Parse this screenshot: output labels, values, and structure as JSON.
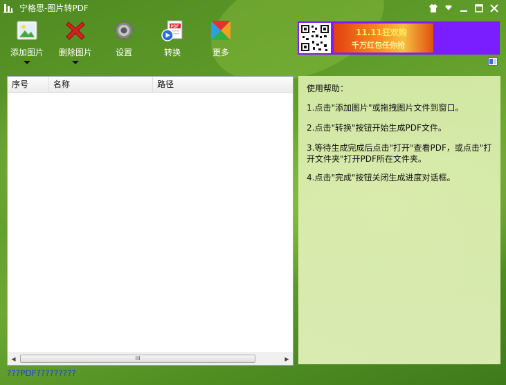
{
  "window": {
    "title": "宁格思-图片转PDF"
  },
  "toolbar": {
    "add_label": "添加图片",
    "delete_label": "删除图片",
    "settings_label": "设置",
    "convert_label": "转换",
    "more_label": "更多"
  },
  "ad": {
    "line1": "11.11狂欢购",
    "line2": "千万红包任你抢"
  },
  "list": {
    "columns": [
      "序号",
      "名称",
      "路径"
    ],
    "scroll_thumb": "III"
  },
  "help": {
    "title": "使用帮助：",
    "step1": "1.点击\"添加图片\"或拖拽图片文件到窗口。",
    "step2": "2.点击\"转换\"按钮开始生成PDF文件。",
    "step3": "3.等待生成完成后点击\"打开\"查看PDF，或点击\"打开文件夹\"打开PDF所在文件夹。",
    "step4": "4.点击\"完成\"按钮关闭生成进度对话框。"
  },
  "footer": {
    "text": "???PDF?????????"
  },
  "colors": {
    "accent": "#5e9a28",
    "ad_bg": "#7a1dff",
    "footer_link": "#1a44d8"
  }
}
